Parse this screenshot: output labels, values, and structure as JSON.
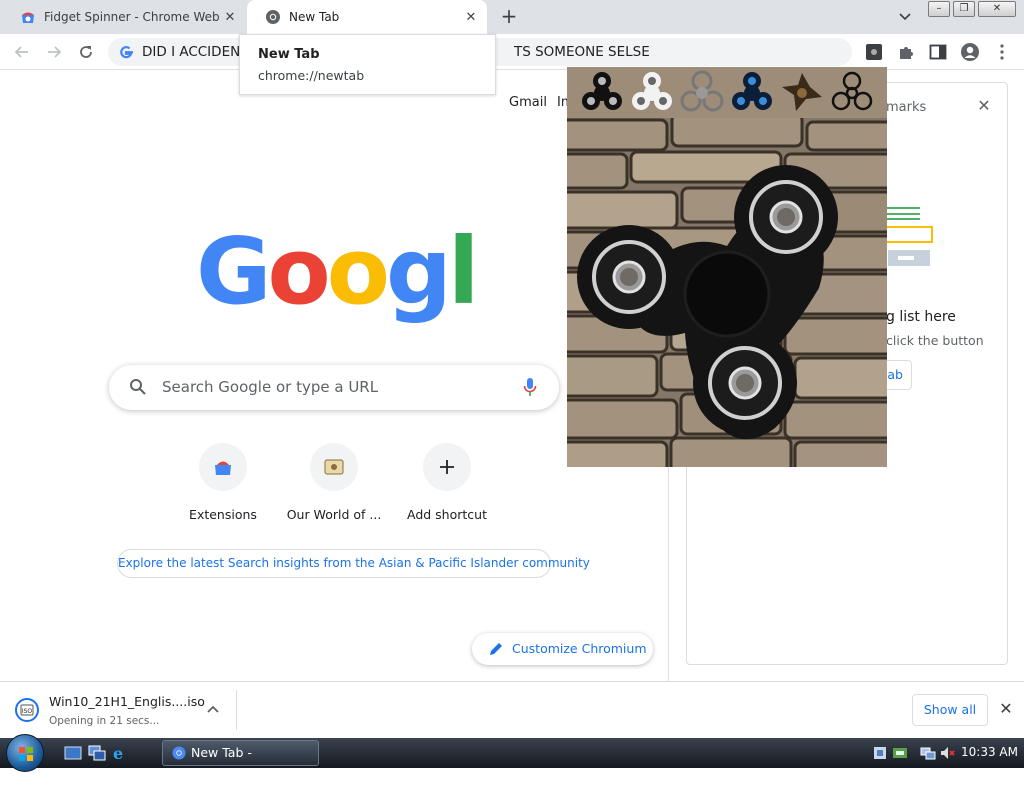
{
  "tabs": [
    {
      "title": "Fidget Spinner - Chrome Web St"
    },
    {
      "title": "New Tab"
    }
  ],
  "tab_tooltip": {
    "title": "New Tab",
    "url": "chrome://newtab"
  },
  "omnibox": {
    "text_left": "DID I ACCIDENT",
    "text_right": "TS SOMEONE SELSE"
  },
  "ntp": {
    "links": {
      "gmail": "Gmail",
      "images": "Im"
    },
    "search_placeholder": "Search Google or type a URL",
    "shortcuts": [
      {
        "label": "Extensions"
      },
      {
        "label": "Our World of ..."
      },
      {
        "label": "Add shortcut"
      }
    ],
    "promo": "Explore the latest Search insights from the Asian & Pacific Islander community",
    "customize": "Customize Chromium"
  },
  "side_panel": {
    "header": "marks",
    "title": "g list here",
    "subtitle": "click the button",
    "button": "ab"
  },
  "download": {
    "filename": "Win10_21H1_Englis....iso",
    "status": "Opening in 21 secs...",
    "show_all": "Show all"
  },
  "taskbar": {
    "window_title": "New Tab - Chromium",
    "clock": "10:33 AM"
  },
  "colors": {
    "accent": "#1a73e8",
    "tabstrip": "#dee1e6",
    "google_blue": "#4285f4",
    "google_red": "#ea4335",
    "google_yellow": "#fbbc05",
    "google_green": "#34a853"
  },
  "icons": [
    "google-favicon",
    "chrome-favicon",
    "back-arrow-icon",
    "forward-arrow-icon",
    "reload-icon",
    "extension-puzzle-icon",
    "side-panel-icon",
    "profile-icon",
    "kebab-menu-icon",
    "search-icon",
    "microphone-icon",
    "pencil-icon",
    "iso-file-icon",
    "chevron-up-icon",
    "close-icon"
  ]
}
